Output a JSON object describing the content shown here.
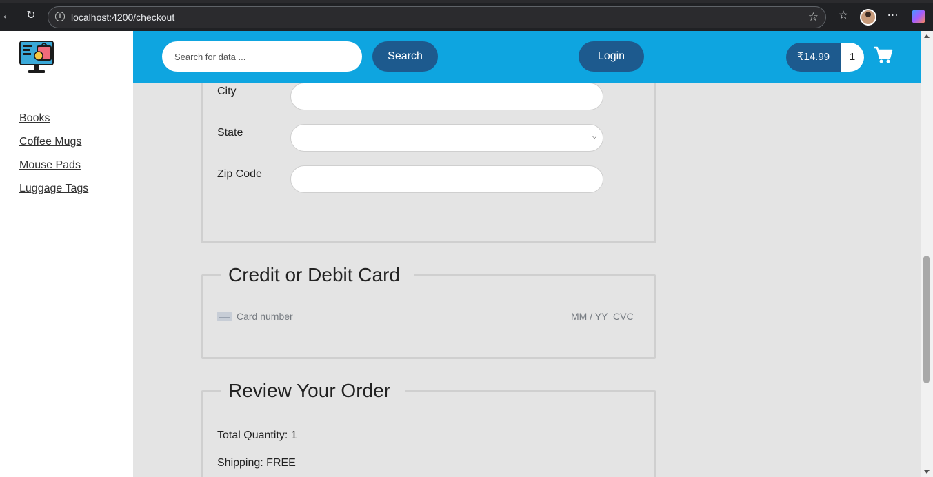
{
  "browser": {
    "url": "localhost:4200/checkout"
  },
  "sidebar": {
    "categories": [
      "Books",
      "Coffee Mugs",
      "Mouse Pads",
      "Luggage Tags"
    ]
  },
  "header": {
    "search_placeholder": "Search for data ...",
    "search_label": "Search",
    "login_label": "Login",
    "cart_total": "₹14.99",
    "cart_quantity": "1"
  },
  "address": {
    "city_label": "City",
    "city_value": "",
    "state_label": "State",
    "state_value": "",
    "zip_label": "Zip Code",
    "zip_value": ""
  },
  "payment": {
    "legend": "Credit or Debit Card",
    "card_number_placeholder": "Card number",
    "expiry_placeholder": "MM / YY",
    "cvc_placeholder": "CVC"
  },
  "review": {
    "legend": "Review Your Order",
    "total_quantity": "Total Quantity: 1",
    "shipping": "Shipping: FREE"
  },
  "colors": {
    "header_bg": "#0ea5e0",
    "button_bg": "#1d5a8e",
    "page_bg": "#e4e4e4"
  }
}
